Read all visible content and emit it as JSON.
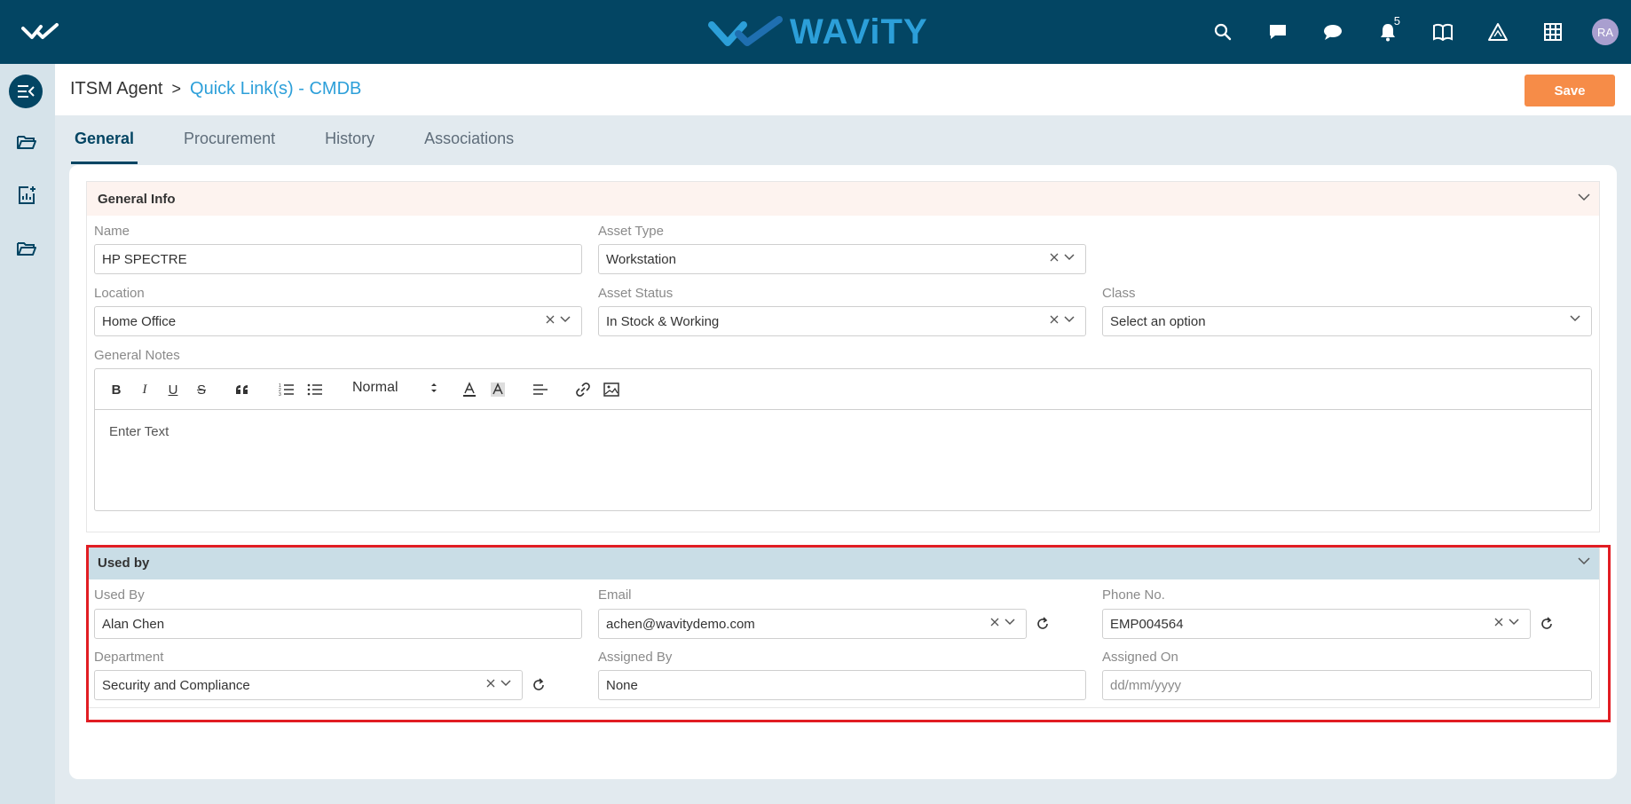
{
  "app": {
    "brand": "WAViTY",
    "notification_count": "5",
    "avatar_initials": "RA"
  },
  "breadcrumb": {
    "root": "ITSM Agent",
    "separator": ">",
    "current": "Quick Link(s) - CMDB"
  },
  "toolbar": {
    "save_label": "Save"
  },
  "tabs": [
    {
      "label": "General"
    },
    {
      "label": "Procurement"
    },
    {
      "label": "History"
    },
    {
      "label": "Associations"
    }
  ],
  "general_info": {
    "title": "General Info",
    "name_label": "Name",
    "name_value": "HP SPECTRE",
    "asset_type_label": "Asset Type",
    "asset_type_value": "Workstation",
    "location_label": "Location",
    "location_value": "Home Office",
    "asset_status_label": "Asset Status",
    "asset_status_value": "In Stock & Working",
    "class_label": "Class",
    "class_placeholder": "Select an option",
    "notes_label": "General Notes",
    "notes_format": "Normal",
    "notes_placeholder": "Enter Text"
  },
  "used_by": {
    "title": "Used by",
    "used_by_label": "Used By",
    "used_by_value": "Alan Chen",
    "email_label": "Email",
    "email_value": "achen@wavitydemo.com",
    "phone_label": "Phone No.",
    "phone_value": "EMP004564",
    "department_label": "Department",
    "department_value": "Security and Compliance",
    "assigned_by_label": "Assigned By",
    "assigned_by_value": "None",
    "assigned_on_label": "Assigned On",
    "assigned_on_placeholder": "dd/mm/yyyy"
  },
  "colors": {
    "topbar": "#034563",
    "brand": "#2c9fd9",
    "save": "#f68c48",
    "general_head": "#fdf3ef",
    "used_by_head": "#c9dde6",
    "highlight": "#e11d23"
  }
}
